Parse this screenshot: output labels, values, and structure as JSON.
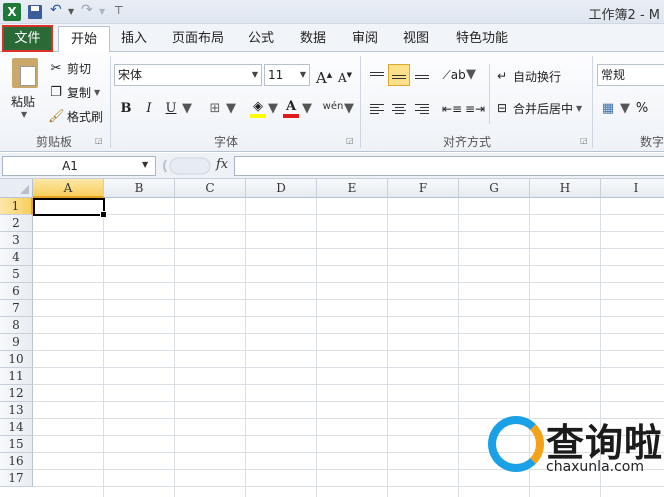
{
  "titlebar": {
    "app_icon": "excel-icon",
    "app_icon_letter": "X",
    "title": "工作簿2 - M"
  },
  "tabs": {
    "file": "文件",
    "items": [
      "开始",
      "插入",
      "页面布局",
      "公式",
      "数据",
      "审阅",
      "视图",
      "特色功能"
    ],
    "active": "开始"
  },
  "ribbon": {
    "clipboard": {
      "paste": "粘贴",
      "cut": "剪切",
      "copy": "复制",
      "format_painter": "格式刷",
      "group_label": "剪贴板"
    },
    "font": {
      "family": "宋体",
      "size": "11",
      "grow": "A",
      "shrink": "A",
      "bold": "B",
      "italic": "I",
      "underline": "U",
      "phonetic": "wén",
      "group_label": "字体",
      "fill_color": "#ffff00",
      "font_color": "#e01b1b"
    },
    "alignment": {
      "wrap_text": "自动换行",
      "merge_center": "合并后居中",
      "group_label": "对齐方式"
    },
    "number": {
      "format": "常规",
      "percent": "%",
      "group_label": "数字"
    }
  },
  "formula_bar": {
    "name_box": "A1",
    "fx": "fx",
    "content": ""
  },
  "grid": {
    "columns": [
      "A",
      "B",
      "C",
      "D",
      "E",
      "F",
      "G",
      "H",
      "I"
    ],
    "rows": [
      "1",
      "2",
      "3",
      "4",
      "5",
      "6",
      "7",
      "8",
      "9",
      "10",
      "11",
      "12",
      "13",
      "14",
      "15",
      "16",
      "17"
    ],
    "active_cell": "A1"
  },
  "watermark": {
    "text": "查询啦",
    "url": "chaxunla.com"
  },
  "colors": {
    "file_tab": "#2b6a36",
    "file_tab_border": "#d9322a",
    "selection_header": "#f8cf5e"
  }
}
